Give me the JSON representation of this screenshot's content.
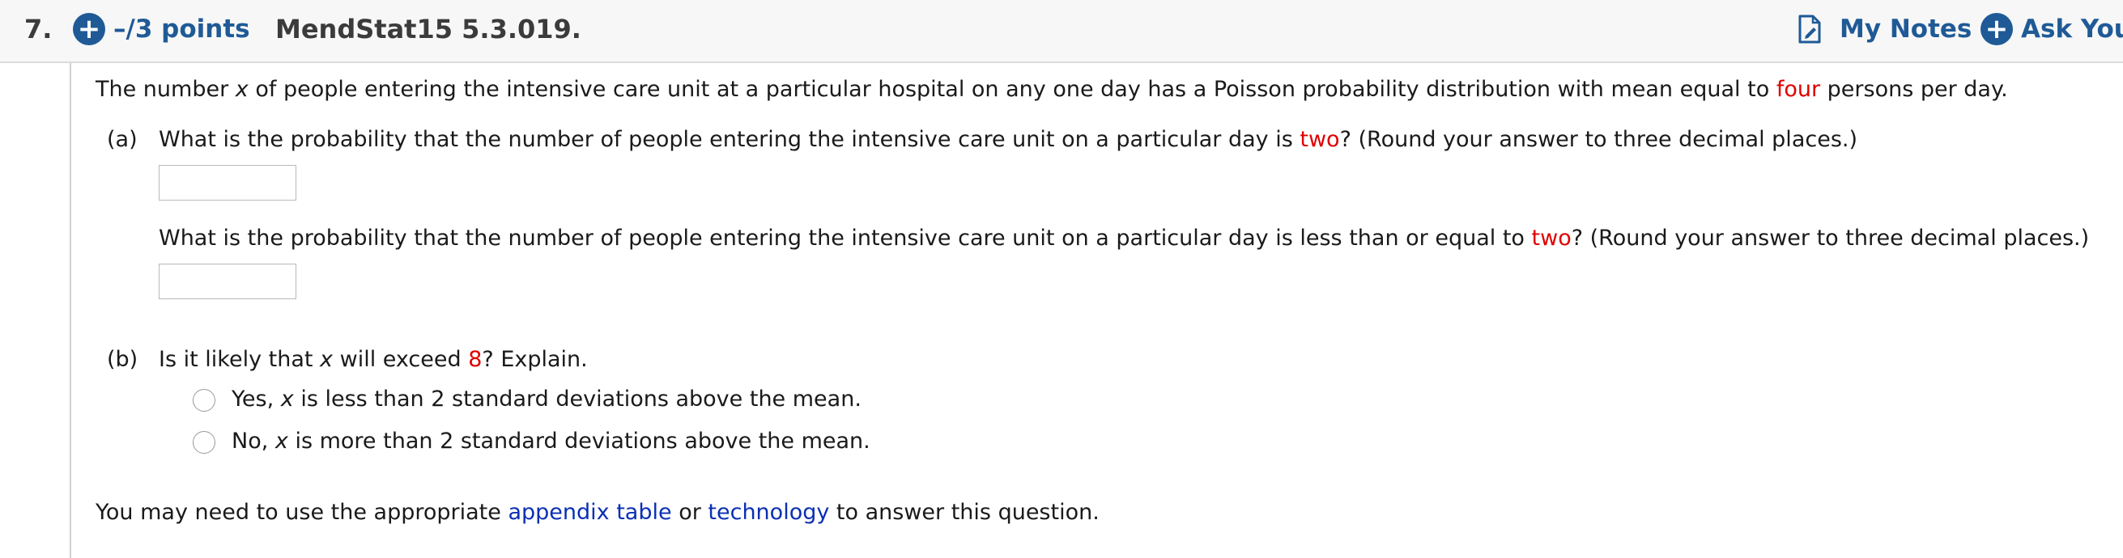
{
  "header": {
    "question_number": "7.",
    "points_label": "–/3 points",
    "question_id": "MendStat15 5.3.019.",
    "my_notes_label": "My Notes",
    "ask_label": "Ask Your"
  },
  "question": {
    "intro_pre": "The number ",
    "intro_var": "x",
    "intro_mid": " of people entering the intensive care unit at a particular hospital on any one day has a Poisson probability distribution with mean equal to ",
    "intro_highlight": "four",
    "intro_post": " persons per day.",
    "part_a": {
      "label": "(a)",
      "q1_pre": "What is the probability that the number of people entering the intensive care unit on a particular day is ",
      "q1_highlight": "two",
      "q1_post": "? (Round your answer to three decimal places.)",
      "answer1_value": "",
      "q2_pre": "What is the probability that the number of people entering the intensive care unit on a particular day is less than or equal to ",
      "q2_highlight": "two",
      "q2_post": "? (Round your answer to three decimal places.)",
      "answer2_value": ""
    },
    "part_b": {
      "label": "(b)",
      "q_pre": "Is it likely that ",
      "q_var": "x",
      "q_mid": " will exceed ",
      "q_highlight": "8",
      "q_post": "? Explain.",
      "options": [
        {
          "pre": "Yes, ",
          "var": "x",
          "post": " is less than 2 standard deviations above the mean.",
          "selected": false
        },
        {
          "pre": "No, ",
          "var": "x",
          "post": " is more than 2 standard deviations above the mean.",
          "selected": false
        }
      ]
    },
    "footer": {
      "pre": "You may need to use the appropriate ",
      "link1": "appendix table",
      "mid": " or ",
      "link2": "technology",
      "post": " to answer this question."
    }
  },
  "colors": {
    "accent_blue": "#1f5a96",
    "highlight_red": "#e00000",
    "link_blue": "#0a2fb4"
  },
  "icons": {
    "points": "plus-circle-icon",
    "notes": "notes-icon",
    "ask": "plus-circle-icon"
  }
}
